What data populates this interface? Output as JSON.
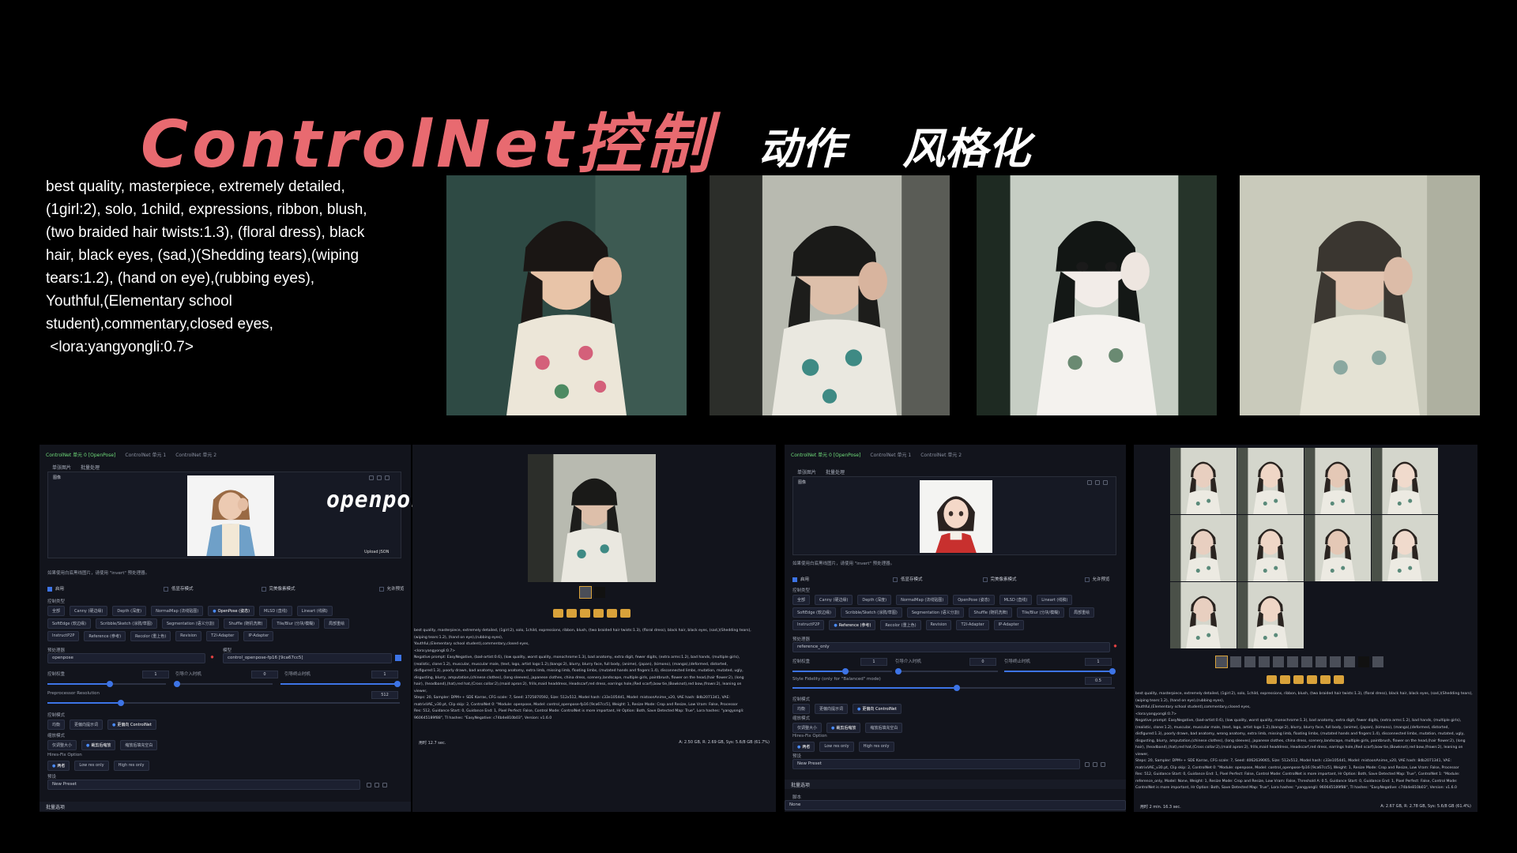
{
  "header": {
    "title": "ControlNet控制",
    "tag_1": "动作",
    "tag_2": "风格化"
  },
  "prompt_text": "best quality, masterpiece, extremely detailed,\n(1girl:2), solo, 1child, expressions, ribbon, blush,\n(two braided hair twists:1.3), (floral dress), black\nhair, black eyes, (sad,)(Shedding tears),(wiping\ntears:1.2), (hand on eye),(rubbing eyes),\nYouthful,(Elementary school\nstudent),commentary,closed eyes,\n <lora:yangyongli:0.7>",
  "overlay_label": "openpose",
  "panel1": {
    "tabs": [
      "ControlNet 单元 0 [OpenPose]",
      "ControlNet 单元 1",
      "ControlNet 单元 2"
    ],
    "subtabs": [
      "单张图片",
      "批量处理"
    ],
    "image_label": "图像",
    "upload_label": "Upload JSON",
    "hint": "如果使用白底黑线图片，请使用 \"invert\" 预处理器。",
    "checks": [
      "启用",
      "低显存模式",
      "完美像素模式",
      "允许预览"
    ],
    "control_type_label": "控制类型",
    "types_row1": [
      "全部",
      "Canny (硬边缘)",
      "Depth (深度)",
      "NormalMap (法线贴图)",
      "OpenPose (姿态)",
      "MLSD (直线)",
      "Lineart (线稿)"
    ],
    "types_row2": [
      "SoftEdge (软边缘)",
      "Scribble/Sketch (涂鸦/草图)",
      "Segmentation (语义分割)",
      "Shuffle (随机洗牌)",
      "Tile/Blur (分块/模糊)",
      "局部重绘"
    ],
    "types_row3": [
      "InstructP2P",
      "Reference (参考)",
      "Recolor (重上色)",
      "Revision",
      "T2I-Adapter",
      "IP-Adapter"
    ],
    "active_type": "OpenPose (姿态)",
    "preprocessor_label": "预处理器",
    "preprocessor": "openpose",
    "model_label": "模型",
    "model": "control_openpose-fp16 [9ca67cc5]",
    "weight_label": "控制权重",
    "weight": "1",
    "start_label": "引导介入时机",
    "start": "0",
    "end_label": "引导终止时机",
    "end": "1",
    "res_label": "Preprocessor Resolution",
    "res": "512",
    "mode_label": "控制模式",
    "modes": [
      "均衡",
      "更偏向提示词",
      "更偏向 ControlNet"
    ],
    "resize_label": "缩放模式",
    "resizes": [
      "仅调整大小",
      "裁剪后缩放",
      "缩放后填充空白"
    ],
    "hires_label": "Hires-Fix Option",
    "hires": [
      "两者",
      "Low res only",
      "High res only"
    ],
    "preset_label": "预设",
    "preset": "New Preset",
    "batch_label": "批量选项"
  },
  "panel2": {
    "output_text": "best quality, masterpiece, extremely detailed, (1girl:2), solo, 1child, expressions, ribbon, blush, (two braided hair twists:1.3), (floral dress), black hair, black eyes, (sad,)(Shedding tears),\n(wiping tears:1.2), (hand on eye),(rubbing eyes),\nYouthful,(Elementary school student),commentary,closed eyes,\n<lora:yangyongli:0.7>\nNegative prompt: EasyNegative, (bad-artist:0.6), (low quality, worst quality, monochrome:1.3), bad anatomy, extra digit, fewer digits, (extra arms:1.2), bad hands, (multiple girls),\n(realistic, clone:1.2), muscular, muscular male, (text, logo, artist logo:1.2),(bangs:2), blurry, blurry face, full body, (anime), (japan), (kimono), (manga),(deformed, distorted,\ndisfigured:1.3), poorly drawn, bad anatomy, wrong anatomy, extra limb, missing limb, floating limbs, (mutated hands and fingers:1.4), disconnected limbs, mutation, mutated, ugly,\ndisgusting, blurry, amputation,(chinese clothes), (long sleeves), japanese clothes, china dress, scenery,landscape, multiple girls, paintbrush, flower on the head,(hair flower:2), (long\nhair), (headband),(hat),red hat,(Cross collar:2),(maid apron:2), frills,maid headdress, Headscarf,red dress, earrings hole,(Red scarf),bow tie,(Bowknot),red bow,(frown:2), leaning on\nviewer,\nSteps: 20, Sampler: DPM++ SDE Karras, CFG scale: 7, Seed: 3725870592, Size: 512x512, Model hash: c33e1054d1, Model: mistoonAnime_v20, VAE hash: 8db2071341, VAE:\nmatrixVAE_v30.pt, Clip skip: 2, ControlNet 0: \"Module: openpose, Model: control_openpose-fp16 [9ca67cc5], Weight: 1, Resize Mode: Crop and Resize, Low Vram: False, Processor\nRes: 512, Guidance Start: 0, Guidance End: 1, Pixel Perfect: False, Control Mode: ControlNet is more important, Hr Option: Both, Save Detected Map: True\", Lora hashes: \"yangyongli:\n960645189f88\", TI hashes: \"EasyNegative: c74b4e810b03\", Version: v1.6.0",
    "time": "用时 12.7 sec.",
    "vram": "A: 2.50 GB, R: 2.69 GB, Sys: 5.6/8 GB (61.7%)"
  },
  "panel3": {
    "tabs": [
      "ControlNet 单元 0 [OpenPose]",
      "ControlNet 单元 1",
      "ControlNet 单元 2"
    ],
    "subtabs": [
      "单张图片",
      "批量处理"
    ],
    "image_label": "图像",
    "hint": "如果使用白底黑线图片，请使用 \"invert\" 预处理器。",
    "checks": [
      "启用",
      "低显存模式",
      "完美像素模式",
      "允许预览"
    ],
    "control_type_label": "控制类型",
    "types_row1": [
      "全部",
      "Canny (硬边缘)",
      "Depth (深度)",
      "NormalMap (法线贴图)",
      "OpenPose (姿态)",
      "MLSD (直线)",
      "Lineart (线稿)"
    ],
    "types_row2": [
      "SoftEdge (软边缘)",
      "Scribble/Sketch (涂鸦/草图)",
      "Segmentation (语义分割)",
      "Shuffle (随机洗牌)",
      "Tile/Blur (分块/模糊)",
      "局部重绘"
    ],
    "types_row3": [
      "InstructP2P",
      "Reference (参考)",
      "Recolor (重上色)",
      "Revision",
      "T2I-Adapter",
      "IP-Adapter"
    ],
    "active_type": "Reference (参考)",
    "preprocessor_label": "预处理器",
    "preprocessor": "reference_only",
    "weight_label": "控制权重",
    "weight": "1",
    "start_label": "引导介入时机",
    "start": "0",
    "end_label": "引导终止时机",
    "end": "1",
    "fidelity_label": "Style Fidelity (only for \"Balanced\" mode)",
    "fidelity": "0.5",
    "mode_label": "控制模式",
    "modes": [
      "均衡",
      "更偏向提示词",
      "更偏向 ControlNet"
    ],
    "resize_label": "缩放模式",
    "resizes": [
      "仅调整大小",
      "裁剪后缩放",
      "缩放后填充空白"
    ],
    "hires_label": "Hires-Fix Option",
    "hires": [
      "两者",
      "Low res only",
      "High res only"
    ],
    "preset_label": "预设",
    "preset": "New Preset",
    "batch_label": "批量选项",
    "script_label": "脚本",
    "script": "None"
  },
  "panel4": {
    "output_text": "best quality, masterpiece, extremely detailed, (1girl:2), solo, 1child, expressions, ribbon, blush, (two braided hair twists:1.3), (floral dress), black hair, black eyes, (sad,)(Shedding tears),\n(wiping tears:1.2), (hand on eye),(rubbing eyes),\nYouthful,(Elementary school student),commentary,closed eyes,\n<lora:yangyongli:0.7>\nNegative prompt: EasyNegative, (bad-artist:0.6), (low quality, worst quality, monochrome:1.3), bad anatomy, extra digit, fewer digits, (extra arms:1.2), bad hands, (multiple girls),\n(realistic, clone:1.2), muscular, muscular male, (text, logo, artist logo:1.2),(bangs:2), blurry, blurry face, full body, (anime), (japan), (kimono), (manga),(deformed, distorted,\ndisfigured:1.3), poorly drawn, bad anatomy, wrong anatomy, extra limb, missing limb, floating limbs, (mutated hands and fingers:1.4), disconnected limbs, mutation, mutated, ugly,\ndisgusting, blurry, amputation,(chinese clothes), (long sleeves), japanese clothes, china dress, scenery,landscape, multiple girls, paintbrush, flower on the head,(hair flower:2), (long\nhair), (headband),(hat),red hat,(Cross collar:2),(maid apron:2), frills,maid headdress, Headscarf,red dress, earrings hole,(Red scarf),bow tie,(Bowknot),red bow,(frown:2), leaning on\nviewer,\nSteps: 20, Sampler: DPM++ SDE Karras, CFG scale: 7, Seed: 4062639065, Size: 512x512, Model hash: c33e1054d1, Model: mistoonAnime_v20, VAE hash: 8db2071341, VAE:\nmatrixVAE_v30.pt, Clip skip: 2, ControlNet 0: \"Module: openpose, Model: control_openpose-fp16 [9ca67cc5], Weight: 1, Resize Mode: Crop and Resize, Low Vram: False, Processor\nRes: 512, Guidance Start: 0, Guidance End: 1, Pixel Perfect: False, Control Mode: ControlNet is more important, Hr Option: Both, Save Detected Map: True\", ControlNet 1: \"Module:\nreference_only, Model: None, Weight: 1, Resize Mode: Crop and Resize, Low Vram: False, Threshold A: 0.5, Guidance Start: 0, Guidance End: 1, Pixel Perfect: False, Control Mode:\nControlNet is more important, Hr Option: Both, Save Detected Map: True\", Lora hashes: \"yangyongli: 960645189f88\", TI hashes: \"EasyNegative: c74b4e810b03\", Version: v1.6.0",
    "time": "用时 2 min. 16.3 sec.",
    "vram": "A: 2.67 GB, R: 2.78 GB, Sys: 5.6/8 GB (61.4%)"
  },
  "colors": {
    "title": "#e86a70",
    "accent_green": "#6fdc7a",
    "accent_blue": "#3d74e6",
    "button_orange": "#d9a23a"
  }
}
